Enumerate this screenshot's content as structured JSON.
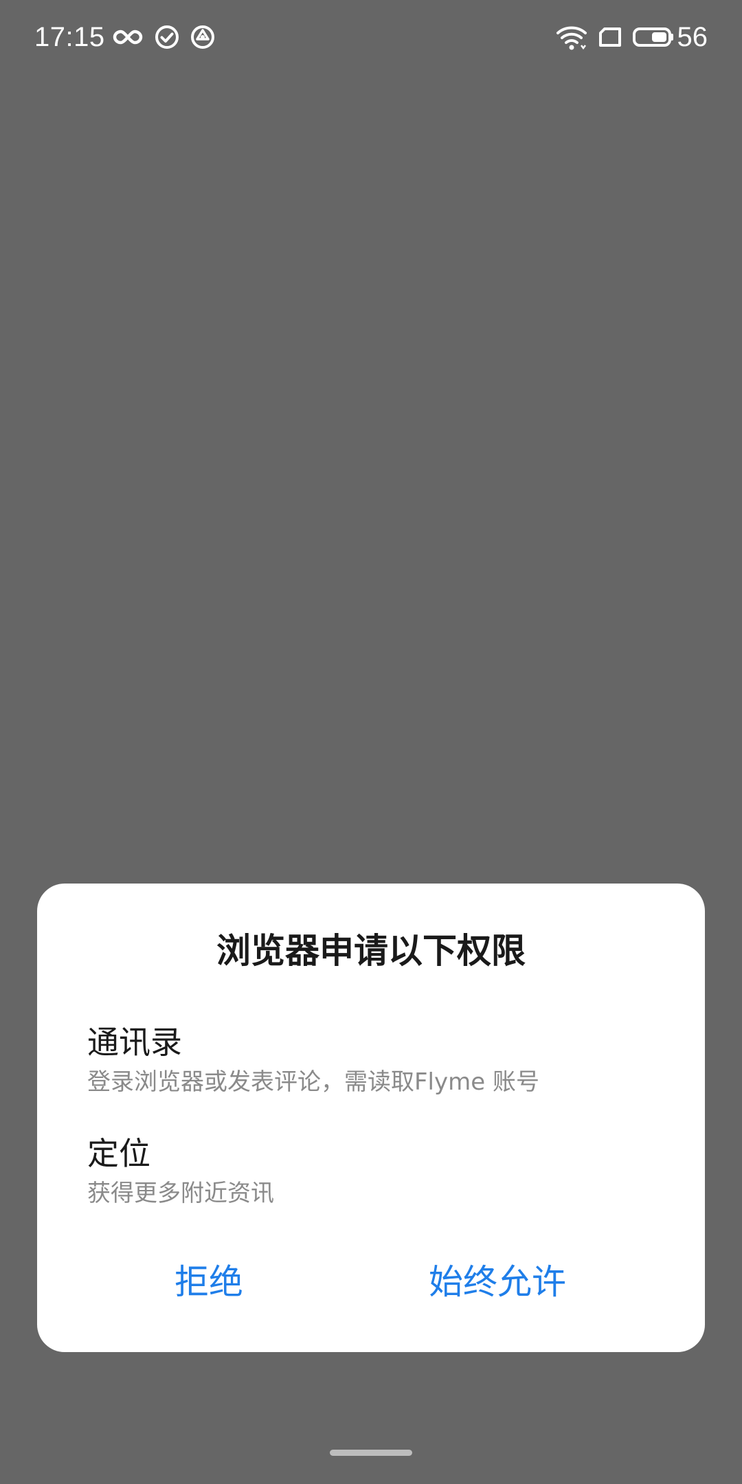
{
  "status_bar": {
    "time": "17:15",
    "battery_percent": "56",
    "icons": [
      "infinity-icon",
      "check-circle-icon",
      "sync-icon",
      "wifi-icon",
      "sim-card-icon",
      "battery-icon"
    ]
  },
  "dialog": {
    "title": "浏览器申请以下权限",
    "permissions": [
      {
        "name": "通讯录",
        "description": "登录浏览器或发表评论，需读取Flyme 账号"
      },
      {
        "name": "定位",
        "description": "获得更多附近资讯"
      }
    ],
    "buttons": {
      "deny": "拒绝",
      "allow": "始终允许"
    }
  },
  "colors": {
    "scrim": "#666666",
    "dialog_bg": "#ffffff",
    "accent": "#1f7ee9",
    "primary_text": "#1a1a1a",
    "secondary_text": "#8a8a8a"
  }
}
